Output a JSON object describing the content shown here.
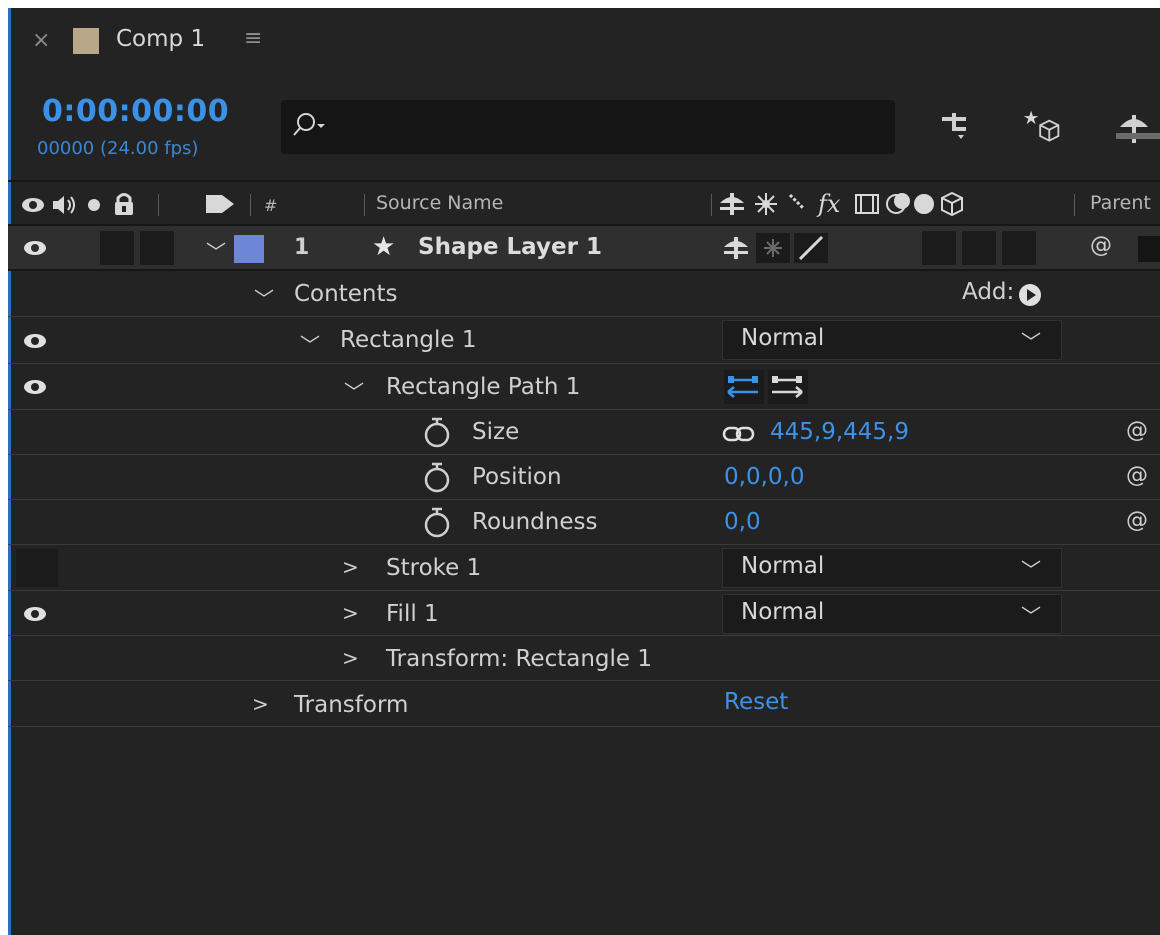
{
  "colors": {
    "accent": "#3b92e8",
    "comp_swatch": "#b7a889",
    "layer_label": "#6e86d8"
  },
  "tab": {
    "close": "×",
    "title": "Comp 1",
    "menu": "≡"
  },
  "header": {
    "timecode": "0:00:00:00",
    "frame_info": "00000 (24.00 fps)"
  },
  "columns": {
    "number": "#",
    "source_name": "Source Name",
    "fx": "fx",
    "parent": "Parent"
  },
  "layer": {
    "number": "1",
    "name": "Shape Layer 1"
  },
  "tree": {
    "contents": "Contents",
    "add_label": "Add:",
    "rectangle": "Rectangle 1",
    "rectangle_path": "Rectangle Path 1",
    "size_label": "Size",
    "size_value": "445,9,445,9",
    "position_label": "Position",
    "position_value": "0,0,0,0",
    "roundness_label": "Roundness",
    "roundness_value": "0,0",
    "stroke": "Stroke 1",
    "fill": "Fill 1",
    "transform_rect": "Transform: Rectangle 1",
    "transform": "Transform",
    "reset": "Reset"
  },
  "blend_modes": {
    "rectangle": "Normal",
    "stroke": "Normal",
    "fill": "Normal"
  }
}
